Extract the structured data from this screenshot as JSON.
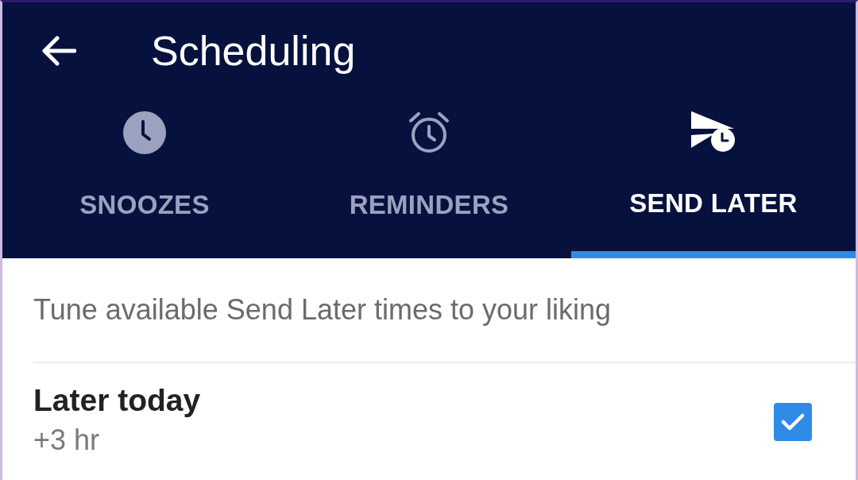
{
  "header": {
    "title": "Scheduling"
  },
  "tabs": [
    {
      "label": "SNOOZES",
      "selected": false
    },
    {
      "label": "REMINDERS",
      "selected": false
    },
    {
      "label": "SEND LATER",
      "selected": true
    }
  ],
  "description": "Tune available Send Later times to your liking",
  "options": [
    {
      "title": "Later today",
      "detail": "+3 hr",
      "checked": true
    }
  ]
}
